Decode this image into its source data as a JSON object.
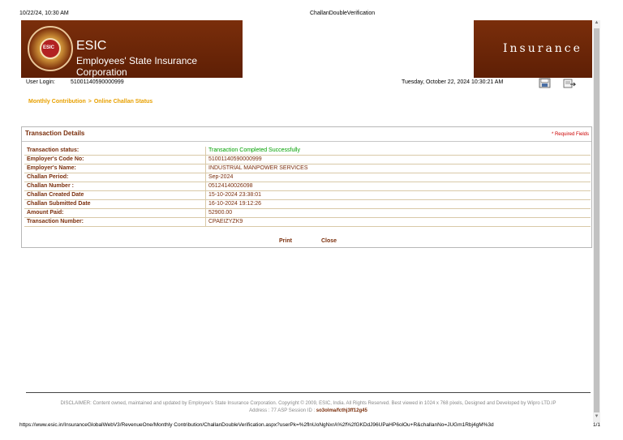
{
  "print_header": {
    "timestamp": "10/22/24, 10:30 AM",
    "page_title": "ChallanDoubleVerification"
  },
  "brand": {
    "title": "ESIC",
    "subtitle": "Employees' State Insurance Corporation",
    "right_banner": "Insurance",
    "logo_text": "ESIC"
  },
  "user": {
    "label": "User Login:",
    "id": "51001140590000999",
    "datetime": "Tuesday, October 22, 2024 10:30:21 AM"
  },
  "icons": {
    "save": "save-icon",
    "export": "export-icon"
  },
  "breadcrumb": {
    "items": [
      "Monthly Contribution",
      "Online Challan Status"
    ],
    "separator": ">"
  },
  "panel": {
    "title": "Transaction Details",
    "required_note": "* Required Fields",
    "rows": [
      {
        "label": "Transaction status:",
        "value": "Transaction Completed Successfully"
      },
      {
        "label": "Employer's Code No:",
        "value": "51001140590000999"
      },
      {
        "label": "Employer's Name:",
        "value": "INDUSTRIAL MANPOWER SERVICES"
      },
      {
        "label": "Challan Period:",
        "value": "Sep-2024"
      },
      {
        "label": "Challan Number :",
        "value": "05124140026098"
      },
      {
        "label": "Challan Created Date",
        "value": "15-10-2024 23:38:01"
      },
      {
        "label": "Challan Submitted Date",
        "value": "16-10-2024 19:12:26"
      },
      {
        "label": "Amount Paid:",
        "value": "52900.00"
      },
      {
        "label": "Transaction Number:",
        "value": "CPAEIZYZK9"
      }
    ],
    "actions": {
      "print": "Print",
      "close": "Close"
    }
  },
  "disclaimer": {
    "text": "DISCLAIMER: Content owned, maintained and updated by Employee's State Insurance Corporation. Copyright © 2009, ESIC, India. All Rights Reserved. Best viewed in 1024 x 768 pixels, Designed and Developed by Wipro LTD.IP",
    "address": "Address : 77 ASP Session ID :",
    "session": "so3olma/fcthj3ff12g45"
  },
  "footer": {
    "url": "https://www.esic.in/InsuranceGlobalWebV3/RevenueOne/Monthly Contribution/ChallanDoubleVerification.aspx?userPk=%2flnUoNgNxrA%2f%2fGKDdJ96UPaHP6olOu+R&challanNo=JUGm1Rbj4gM%3d",
    "page": "1/1"
  },
  "colors": {
    "brand": "#7a2e0b",
    "accent": "#e8a000",
    "success": "#00a000",
    "required": "#cc0000"
  }
}
